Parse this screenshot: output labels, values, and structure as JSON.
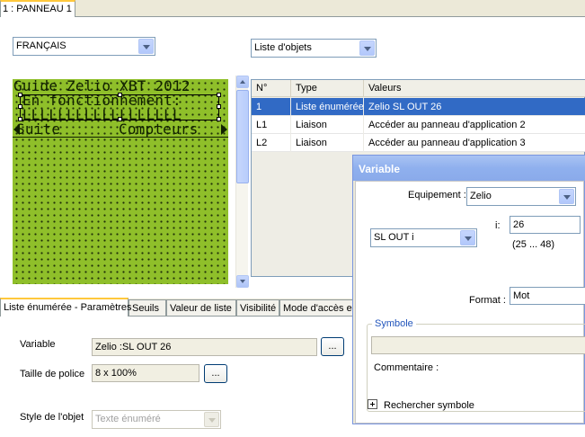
{
  "document_tab": {
    "label": "1 : PANNEAU 1"
  },
  "language_combo": {
    "value": "FRANÇAIS"
  },
  "object_list_combo": {
    "value": "Liste d'objets"
  },
  "lcd": {
    "line1": "Guide Zelio XBT 2012",
    "line2": " En fonctionnement:",
    "line3": " LLLLLLLLLLLLLLLLLL",
    "line4_left": "Suite",
    "line4_right": "Compteurs"
  },
  "objects_table": {
    "columns": [
      "N°",
      "Type",
      "Valeurs"
    ],
    "rows": [
      {
        "num": "1",
        "type": "Liste énumérée",
        "value": "Zelio SL OUT 26",
        "selected": true
      },
      {
        "num": "L1",
        "type": "Liaison",
        "value": "Accéder au panneau d'application 2",
        "selected": false
      },
      {
        "num": "L2",
        "type": "Liaison",
        "value": "Accéder au panneau d'application 3",
        "selected": false
      }
    ]
  },
  "bottom_tabs": [
    "Liste énumérée - Paramètres",
    "Seuils",
    "Valeur de liste",
    "Visibilité",
    "Mode d'accès e"
  ],
  "params": {
    "variable_label": "Variable",
    "variable_value": "Zelio :SL OUT 26",
    "font_size_label": "Taille de police",
    "font_size_value": "8 x 100%",
    "object_style_label": "Style de l'objet",
    "object_style_value": "Texte énuméré",
    "browse_label": "..."
  },
  "variable_dialog": {
    "title": "Variable",
    "equipment_label": "Equipement :",
    "equipment_value": "Zelio",
    "var_type_value": "SL OUT i",
    "index_label": "i:",
    "index_value": "26",
    "index_range": "(25 ... 48)",
    "format_label": "Format :",
    "format_value": "Mot",
    "symbol_group_label": "Symbole",
    "symbol_value": "",
    "comment_label": "Commentaire :",
    "search_symbol_label": "Rechercher symbole"
  },
  "colors": {
    "lcd_background": "#8fbf2a",
    "selection_blue": "#316ac5",
    "tab_accent": "#ffc83c",
    "dialog_title": "#8fb0ee"
  }
}
